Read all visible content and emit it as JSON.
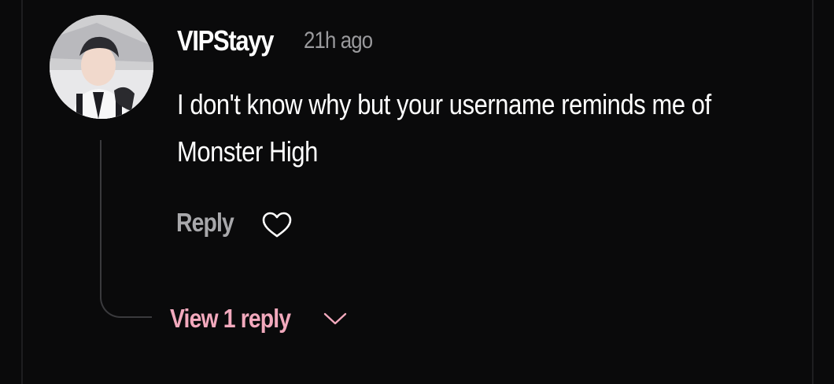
{
  "comment": {
    "username": "VIPStayy",
    "timestamp": "21h ago",
    "text": "I don't know why but your username reminds me of Monster High",
    "avatar": {
      "icon": "user-avatar-photo"
    }
  },
  "actions": {
    "reply_label": "Reply",
    "like_icon": "heart-outline-icon"
  },
  "replies": {
    "view_label": "View 1 reply",
    "expand_icon": "chevron-down-icon",
    "accent_color": "#f2a9bd"
  },
  "colors": {
    "background": "#0a0a0b",
    "text_primary": "#ffffff",
    "text_secondary": "#9a9a9d"
  }
}
